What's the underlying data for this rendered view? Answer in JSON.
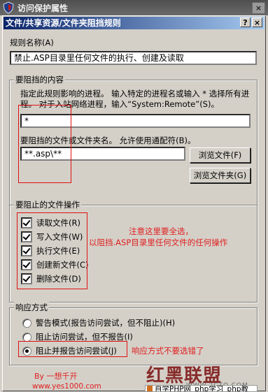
{
  "outer_window": {
    "title": "访问保护属性",
    "close_label": "×"
  },
  "dialog": {
    "title": "文件/共享资源/文件夹阻挡规则",
    "help_label": "?",
    "close_label": "×"
  },
  "rule_name": {
    "label": "规则名称(A)",
    "value": "禁止.ASP目录里任何文件的执行、创建及读取"
  },
  "block_content": {
    "title": "要阻挡的内容",
    "description": "指定此规则影响的进程。 输入特定的进程名或输入 * 选择所有进程。 对于入站网络进程，输入“System:Remote”(S)。",
    "process_value": "*",
    "files_label": "要阻挡的文件或文件夹名。 允许使用通配符(B)。",
    "files_value": "**.asp\\**",
    "browse_file_label": "浏览文件(F)",
    "browse_folder_label": "浏览文件夹(G)"
  },
  "file_ops": {
    "title": "要阻止的文件操作",
    "items": [
      {
        "label": "读取文件(R)",
        "checked": true
      },
      {
        "label": "写入文件(W)",
        "checked": true
      },
      {
        "label": "执行文件(E)",
        "checked": true
      },
      {
        "label": "创建新文件(C)",
        "checked": true
      },
      {
        "label": "删除文件(D)",
        "checked": true
      }
    ]
  },
  "response": {
    "title": "响应方式",
    "options": [
      {
        "label": "警告模式(报告访问尝试，但不阻止)(H)",
        "selected": false
      },
      {
        "label": "阻止访问尝试，但不报告(I)",
        "selected": false
      },
      {
        "label": "阻止并报告访问尝试(J)",
        "selected": true
      }
    ]
  },
  "annotations": {
    "note1": "注意这里要全选，",
    "note2": "以阻挡.ASP目录里任何文件的任何操作",
    "note3": "响应方式不要选错了",
    "author": "By 一想千开",
    "site": "www.yes1000.com",
    "watermark_logo": "红黑联盟",
    "watermark_url": "WWW.2CTO.COM",
    "bottom_bar": "自学PHP网_php学习_php教"
  },
  "colors": {
    "accent": "#0a246a",
    "annotation": "#e02020"
  }
}
